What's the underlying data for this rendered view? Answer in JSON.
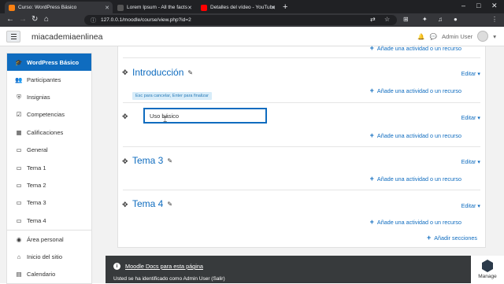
{
  "browser": {
    "tabs": [
      {
        "label": "Curso: WordPress Básico",
        "active": true,
        "favicon_color": "#f98012"
      },
      {
        "label": "Lorem Ipsum - All the facts - Li",
        "active": false,
        "favicon_color": "#555555"
      },
      {
        "label": "Detalles del vídeo - YouTube St",
        "active": false,
        "favicon_color": "#ff0000"
      }
    ],
    "url": "127.0.0.1/moodle/course/view.php?id=2"
  },
  "navbar": {
    "site_name": "miacademiaenlinea",
    "user_name": "Admin User"
  },
  "sidebar": {
    "primary": [
      {
        "label": "WordPress Básico",
        "icon": "graduation-cap-icon",
        "glyph": "🎓",
        "active": true
      },
      {
        "label": "Participantes",
        "icon": "users-icon",
        "glyph": "👥"
      },
      {
        "label": "Insignias",
        "icon": "shield-icon",
        "glyph": "⛨"
      },
      {
        "label": "Competencias",
        "icon": "check-square-icon",
        "glyph": "☑"
      },
      {
        "label": "Calificaciones",
        "icon": "table-icon",
        "glyph": "▦"
      },
      {
        "label": "General",
        "icon": "folder-icon",
        "glyph": "▭"
      },
      {
        "label": "Tema 1",
        "icon": "folder-icon",
        "glyph": "▭"
      },
      {
        "label": "Tema 2",
        "icon": "folder-icon",
        "glyph": "▭"
      },
      {
        "label": "Tema 3",
        "icon": "folder-icon",
        "glyph": "▭"
      },
      {
        "label": "Tema 4",
        "icon": "folder-icon",
        "glyph": "▭"
      }
    ],
    "secondary": [
      {
        "label": "Área personal",
        "icon": "tachometer-icon",
        "glyph": "◉"
      },
      {
        "label": "Inicio del sitio",
        "icon": "home-icon",
        "glyph": "⌂"
      },
      {
        "label": "Calendario",
        "icon": "calendar-icon",
        "glyph": "▤"
      }
    ]
  },
  "main": {
    "add_activity_label": "Añade una actividad o un recurso",
    "edit_label": "Editar",
    "add_sections_label": "Añadir secciones",
    "sections": [
      {
        "title": "Introducción"
      },
      {
        "title": "Tema 3"
      },
      {
        "title": "Tema 4"
      }
    ],
    "editing": {
      "hint": "Esc para cancelar, Enter para finalizar",
      "value": "Uso básico"
    }
  },
  "footer": {
    "docs_link": "Moodle Docs para esta página",
    "logged_in": "Usted se ha identificado como Admin User (Salir)",
    "manage_label": "Manage"
  },
  "colors": {
    "brand": "#0f6cbf",
    "footer_bg": "#373a3c"
  }
}
